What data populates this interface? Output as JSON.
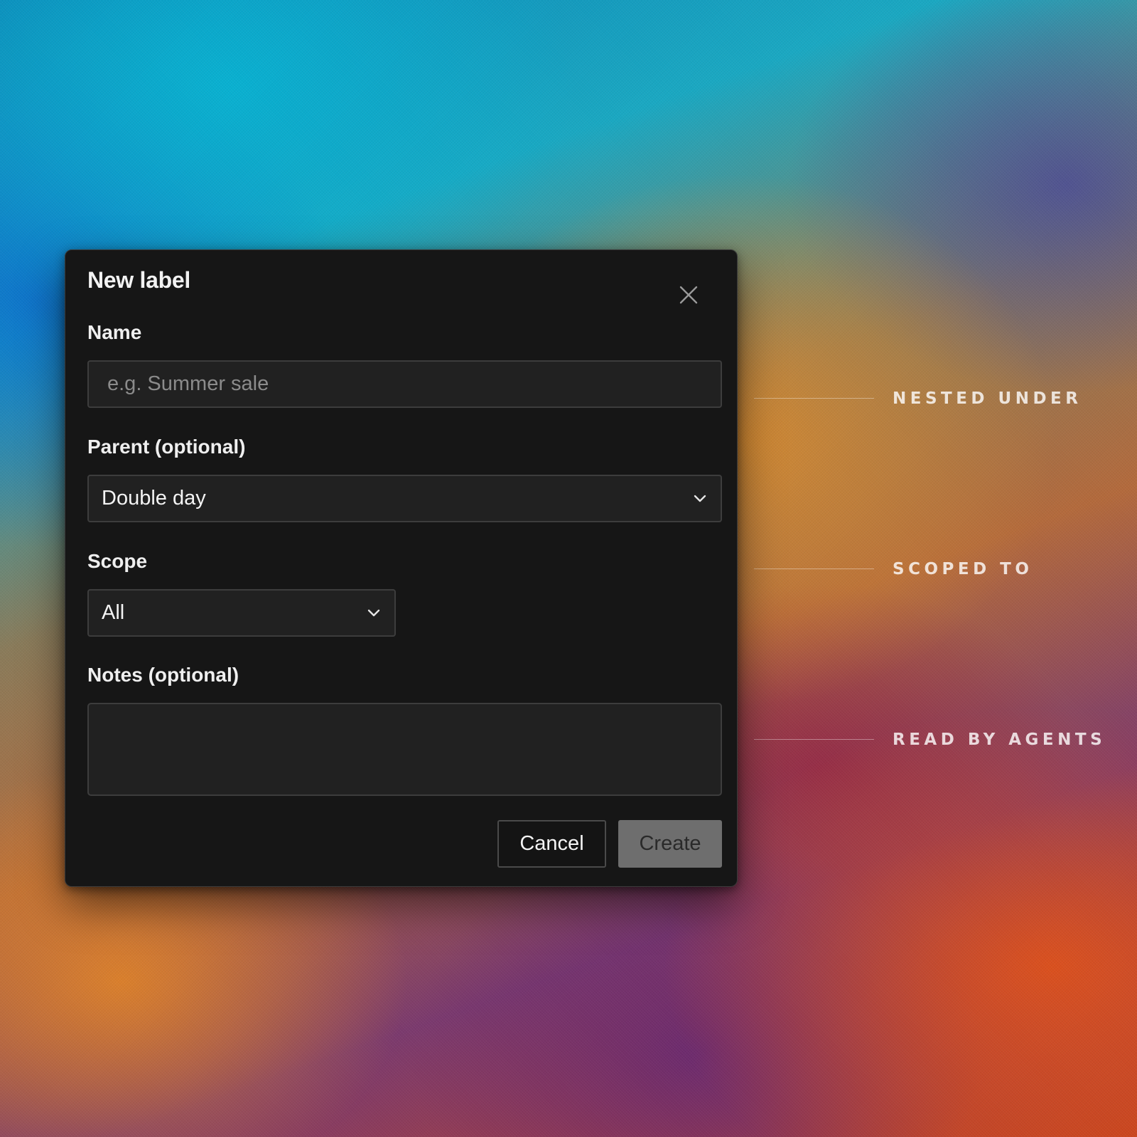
{
  "dialog": {
    "title": "New label",
    "close_icon": "close-icon",
    "fields": {
      "name": {
        "label": "Name",
        "value": "",
        "placeholder": "e.g. Summer sale"
      },
      "parent": {
        "label": "Parent (optional)",
        "selected": "Double day"
      },
      "scope": {
        "label": "Scope",
        "selected": "All"
      },
      "notes": {
        "label": "Notes (optional)",
        "value": ""
      }
    },
    "buttons": {
      "cancel": "Cancel",
      "create": "Create"
    }
  },
  "callouts": [
    {
      "text": "NESTED UNDER"
    },
    {
      "text": "SCOPED TO"
    },
    {
      "text": "READ BY AGENTS"
    }
  ],
  "colors": {
    "dialog_background": "#161616",
    "input_background": "#212121",
    "create_button_background": "#6e6e6e"
  }
}
